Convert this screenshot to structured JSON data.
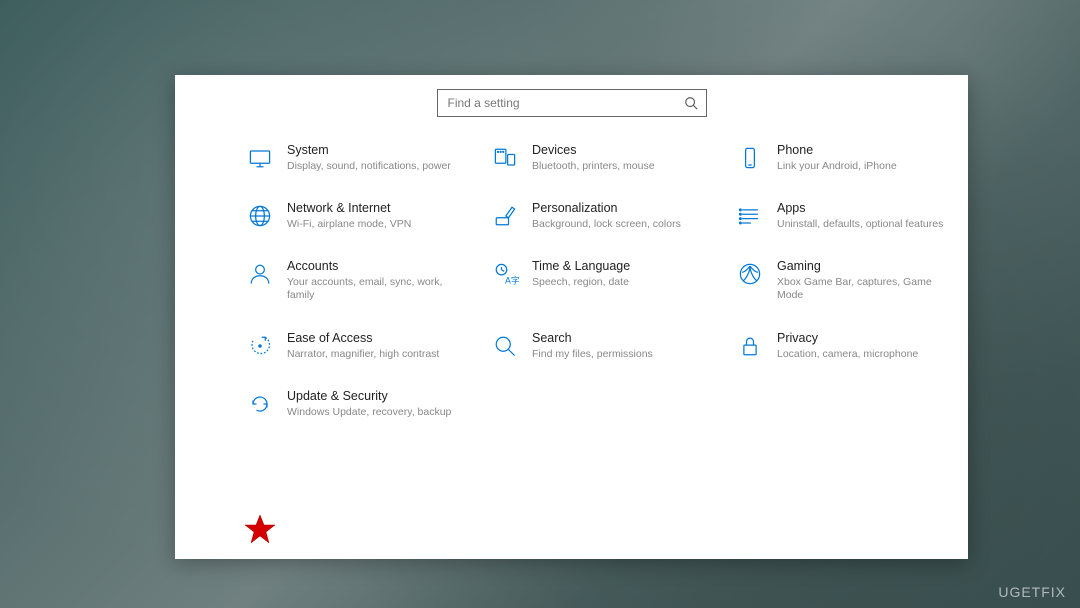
{
  "search": {
    "placeholder": "Find a setting"
  },
  "watermark": "UGETFIX",
  "categories": [
    {
      "id": "system",
      "title": "System",
      "desc": "Display, sound, notifications, power"
    },
    {
      "id": "devices",
      "title": "Devices",
      "desc": "Bluetooth, printers, mouse"
    },
    {
      "id": "phone",
      "title": "Phone",
      "desc": "Link your Android, iPhone"
    },
    {
      "id": "network",
      "title": "Network & Internet",
      "desc": "Wi-Fi, airplane mode, VPN"
    },
    {
      "id": "personalization",
      "title": "Personalization",
      "desc": "Background, lock screen, colors"
    },
    {
      "id": "apps",
      "title": "Apps",
      "desc": "Uninstall, defaults, optional features"
    },
    {
      "id": "accounts",
      "title": "Accounts",
      "desc": "Your accounts, email, sync, work, family"
    },
    {
      "id": "time",
      "title": "Time & Language",
      "desc": "Speech, region, date"
    },
    {
      "id": "gaming",
      "title": "Gaming",
      "desc": "Xbox Game Bar, captures, Game Mode"
    },
    {
      "id": "ease",
      "title": "Ease of Access",
      "desc": "Narrator, magnifier, high contrast"
    },
    {
      "id": "search",
      "title": "Search",
      "desc": "Find my files, permissions"
    },
    {
      "id": "privacy",
      "title": "Privacy",
      "desc": "Location, camera, microphone"
    },
    {
      "id": "update",
      "title": "Update & Security",
      "desc": "Windows Update, recovery, backup"
    }
  ],
  "highlight": "update"
}
